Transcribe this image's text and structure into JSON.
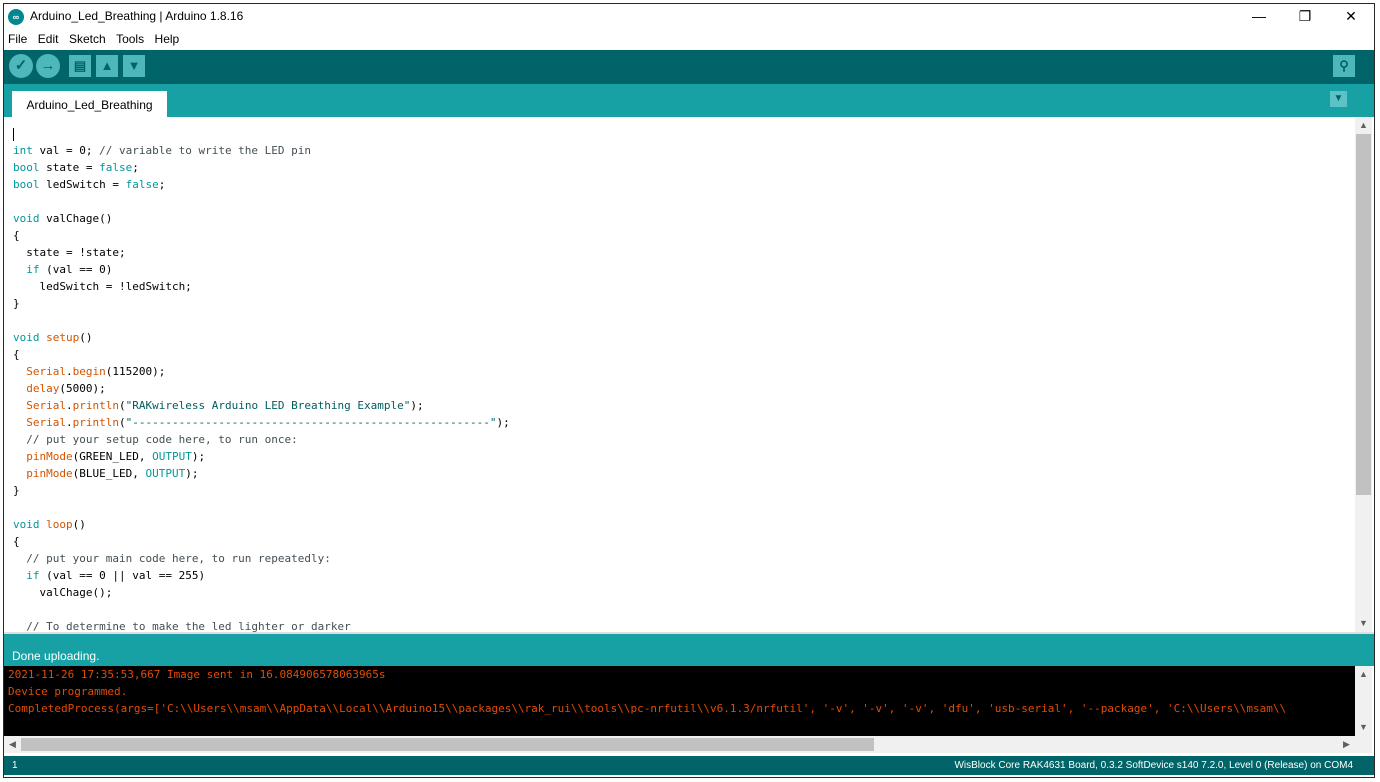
{
  "window": {
    "title": "Arduino_Led_Breathing | Arduino 1.8.16",
    "app_icon": "∞",
    "controls": {
      "minimize": "—",
      "restore": "❐",
      "close": "✕"
    }
  },
  "menu": [
    "File",
    "Edit",
    "Sketch",
    "Tools",
    "Help"
  ],
  "toolbar": {
    "verify": "✓",
    "upload": "→",
    "new": "▤",
    "open": "▲",
    "save": "▼",
    "serial_monitor": "⚲"
  },
  "tabs": [
    {
      "label": "Arduino_Led_Breathing"
    }
  ],
  "tab_menu": "▼",
  "status": {
    "message": "Done uploading."
  },
  "console": {
    "lines": [
      "2021-11-26 17:35:53,667 Image sent in 16.084906578063965s",
      "Device programmed.",
      "CompletedProcess(args=['C:\\\\Users\\\\msam\\\\AppData\\\\Local\\\\Arduino15\\\\packages\\\\rak_rui\\\\tools\\\\pc-nrfutil\\\\v6.1.3/nrfutil', '-v', '-v', '-v', 'dfu', 'usb-serial', '--package', 'C:\\\\Users\\\\msam\\\\"
    ]
  },
  "scroll": {
    "up": "▲",
    "down": "▼",
    "left": "◀",
    "right": "▶"
  },
  "footer": {
    "line_number": "1",
    "board_info": "WisBlock Core RAK4631 Board, 0.3.2 SoftDevice s140 7.2.0, Level 0 (Release) on COM4"
  },
  "code": {
    "l2_kw": "int",
    "l2_rest": " val = 0; ",
    "l2_cmt": "// variable to write the LED pin",
    "l3_kw": "bool",
    "l3_rest": " state = ",
    "l3_val": "false",
    "l3_end": ";",
    "l4_kw": "bool",
    "l4_rest": " ledSwitch = ",
    "l4_val": "false",
    "l4_end": ";",
    "l6_kw": "void",
    "l6_rest": " valChage()",
    "l7": "{",
    "l8": "  state = !state;",
    "l9_ind": "  ",
    "l9_kw": "if",
    "l9_rest": " (val == 0)",
    "l10": "    ledSwitch = !ledSwitch;",
    "l11": "}",
    "l13_kw": "void",
    "l13_sp": " ",
    "l13_fn": "setup",
    "l13_rest": "()",
    "l14": "{",
    "l15_ind": "  ",
    "l15_obj": "Serial",
    "l15_dot": ".",
    "l15_fn": "begin",
    "l15_rest": "(115200);",
    "l16_ind": "  ",
    "l16_fn": "delay",
    "l16_rest": "(5000);",
    "l17_ind": "  ",
    "l17_obj": "Serial",
    "l17_dot": ".",
    "l17_fn": "println",
    "l17_p1": "(",
    "l17_str": "\"RAKwireless Arduino LED Breathing Example\"",
    "l17_p2": ");",
    "l18_ind": "  ",
    "l18_obj": "Serial",
    "l18_dot": ".",
    "l18_fn": "println",
    "l18_p1": "(",
    "l18_str": "\"------------------------------------------------------\"",
    "l18_p2": ");",
    "l19_ind": "  ",
    "l19_cmt": "// put your setup code here, to run once:",
    "l20_ind": "  ",
    "l20_fn": "pinMode",
    "l20_p1": "(GREEN_LED, ",
    "l20_kw": "OUTPUT",
    "l20_p2": ");",
    "l21_ind": "  ",
    "l21_fn": "pinMode",
    "l21_p1": "(BLUE_LED, ",
    "l21_kw": "OUTPUT",
    "l21_p2": ");",
    "l22": "}",
    "l24_kw": "void",
    "l24_sp": " ",
    "l24_fn": "loop",
    "l24_rest": "()",
    "l25": "{",
    "l26_ind": "  ",
    "l26_cmt": "// put your main code here, to run repeatedly:",
    "l27_ind": "  ",
    "l27_kw": "if",
    "l27_rest": " (val == 0 || val == 255)",
    "l28": "    valChage();",
    "l30_ind": "  ",
    "l30_cmt": "// To determine to make the led lighter or darker"
  }
}
